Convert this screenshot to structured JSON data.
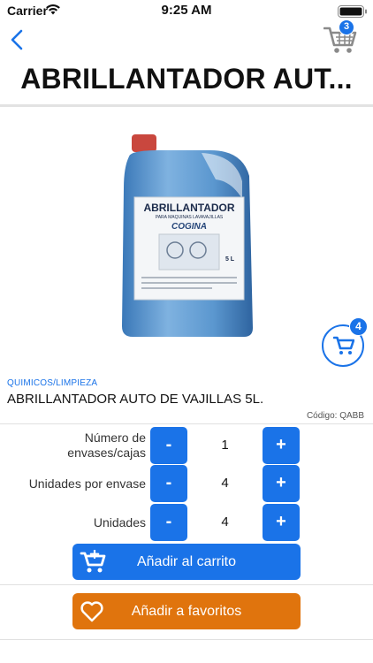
{
  "status_bar": {
    "carrier": "Carrier",
    "time": "9:25 AM"
  },
  "header": {
    "title": "ABRILLANTADOR AUT...",
    "cart_count": "3",
    "accent_color": "#1a73e8"
  },
  "product": {
    "image_icon": "detergent-jug",
    "label_text": "ABRILLANTADOR",
    "label_sub": "PARA MAQUINAS LAVAVAJILLAS",
    "label_brand": "COGINA",
    "label_volume": "5 L",
    "category": "QUIMICOS/LIMPIEZA",
    "name": "ABRILLANTADOR AUTO DE VAJILLAS 5L.",
    "code": "Código: QABB",
    "floating_cart_count": "4"
  },
  "quantity": {
    "rows": [
      {
        "label": "Número de envases/cajas",
        "value": "1",
        "minus": "-",
        "plus": "+"
      },
      {
        "label": "Unidades por envase",
        "value": "4",
        "minus": "-",
        "plus": "+"
      },
      {
        "label": "Unidades",
        "value": "4",
        "minus": "-",
        "plus": "+"
      }
    ]
  },
  "actions": {
    "add_to_cart": "Añadir al carrito",
    "add_to_favorites": "Añadir a favoritos",
    "cart_color": "#1a73e8",
    "favorites_color": "#e0740d"
  }
}
